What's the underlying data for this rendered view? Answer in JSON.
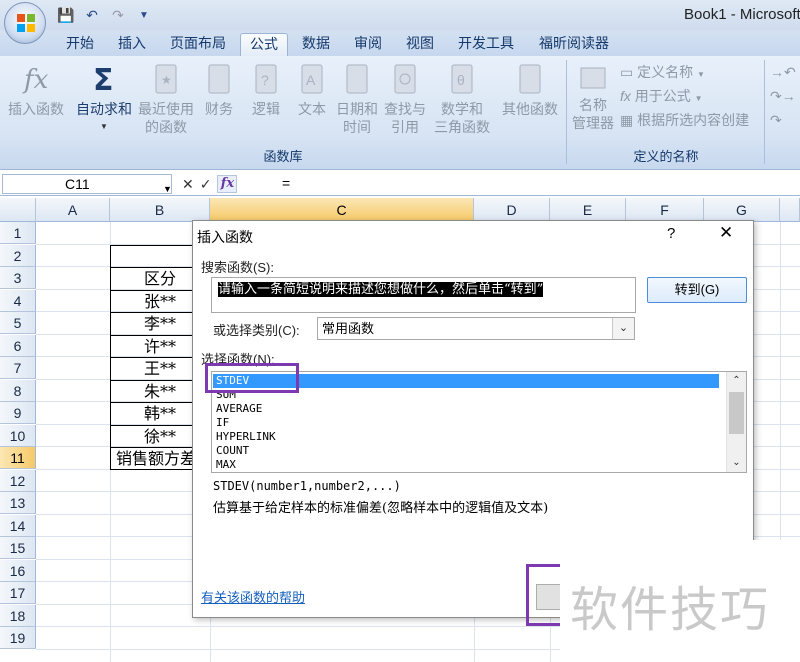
{
  "window": {
    "title": "Book1 - Microsoft"
  },
  "ribbon": {
    "tabs": [
      "开始",
      "插入",
      "页面布局",
      "公式",
      "数据",
      "审阅",
      "视图",
      "开发工具",
      "福昕阅读器"
    ],
    "active_tab": "公式",
    "function_library": {
      "label": "函数库",
      "insert_function": "插入函数",
      "autosum": "自动求和",
      "recent_line1": "最近使用",
      "recent_line2": "的函数",
      "financial": "财务",
      "logical": "逻辑",
      "text": "文本",
      "datetime_line1": "日期和",
      "datetime_line2": "时间",
      "lookup_line1": "查找与",
      "lookup_line2": "引用",
      "math_line1": "数学和",
      "math_line2": "三角函数",
      "more": "其他函数"
    },
    "defined_names": {
      "label": "定义的名称",
      "name_manager_line1": "名称",
      "name_manager_line2": "管理器",
      "define_name": "定义名称",
      "use_in_formula": "用于公式",
      "create_from_selection": "根据所选内容创建"
    }
  },
  "formula_bar": {
    "name_box": "C11",
    "formula": "="
  },
  "sheet": {
    "columns": [
      "A",
      "B",
      "C",
      "D",
      "E",
      "F",
      "G"
    ],
    "rows": [
      "1",
      "2",
      "3",
      "4",
      "5",
      "6",
      "7",
      "8",
      "9",
      "10",
      "11",
      "12",
      "13",
      "14",
      "15",
      "16",
      "17",
      "18",
      "19"
    ],
    "selected_cell": "C11",
    "column_b": [
      "区分",
      "张**",
      "李**",
      "许**",
      "王**",
      "朱**",
      "韩**",
      "徐**",
      "销售额方差"
    ]
  },
  "dialog": {
    "title": "插入函数",
    "help_symbol": "?",
    "close_symbol": "✕",
    "search_label": "搜索函数(S):",
    "search_value": "请输入一条简短说明来描述您想做什么，然后单击“转到”",
    "goto_button": "转到(G)",
    "category_label": "或选择类别(C):",
    "category_value": "常用函数",
    "list_label": "选择函数(N):",
    "functions": [
      "STDEV",
      "SUM",
      "AVERAGE",
      "IF",
      "HYPERLINK",
      "COUNT",
      "MAX"
    ],
    "selected_function": "STDEV",
    "signature": "STDEV(number1,number2,...)",
    "description": "估算基于给定样本的标准偏差(忽略样本中的逻辑值及文本)",
    "help_link": "有关该函数的帮助"
  },
  "watermark": "软件技巧",
  "colors": {
    "highlight_box": "#7d3ab0",
    "selection": "#3399ff"
  }
}
